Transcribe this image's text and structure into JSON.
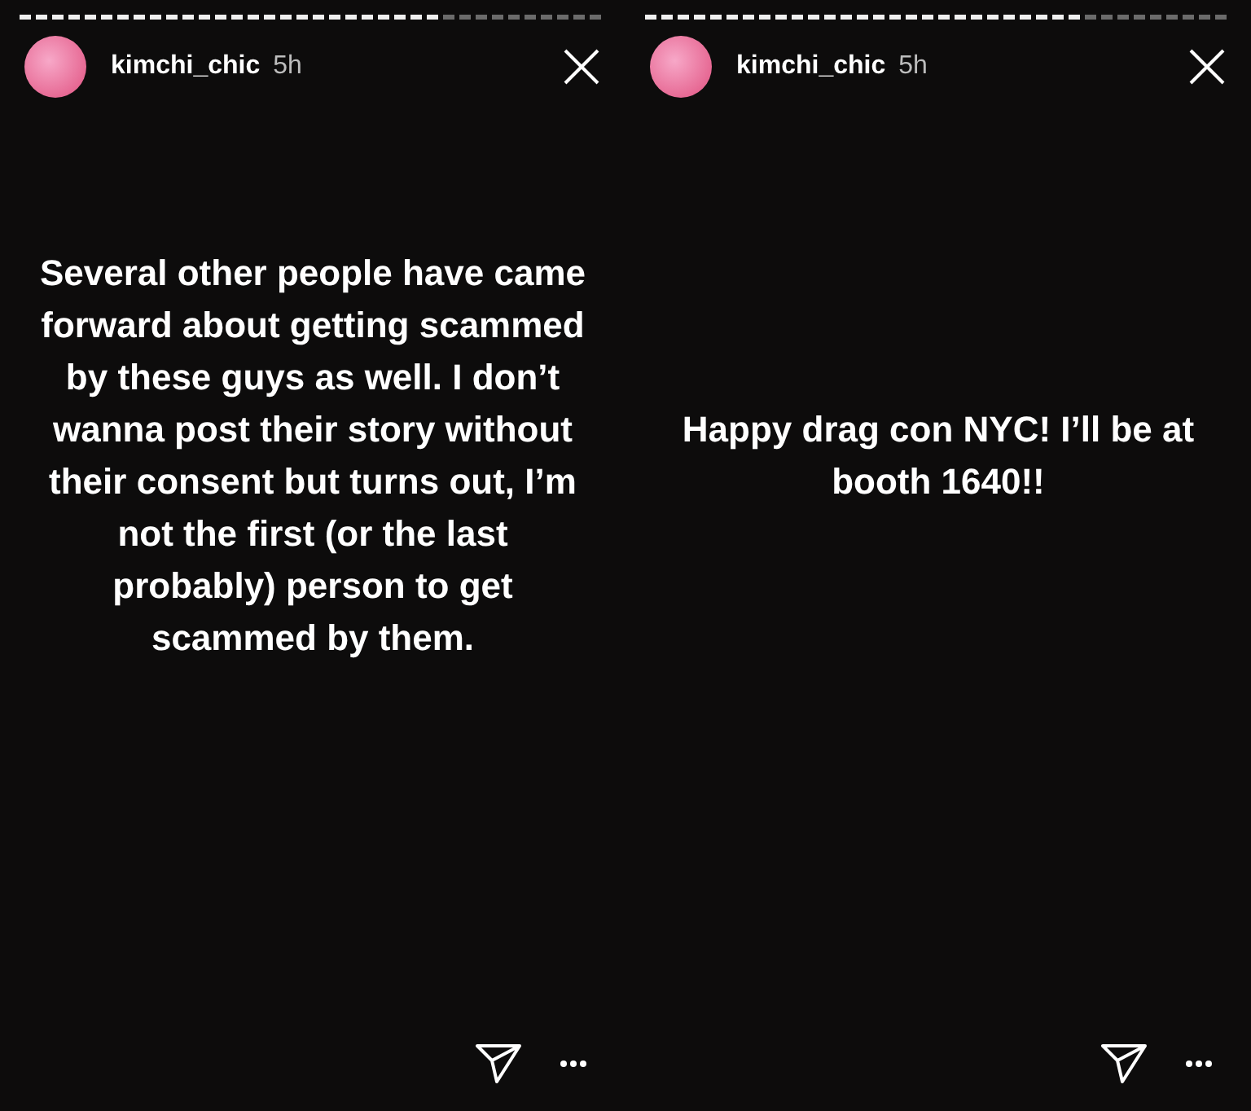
{
  "stories": [
    {
      "progress": {
        "level": 0.73
      },
      "username": "kimchi_chic",
      "time": "5h",
      "message": "Several other people have came forward about getting scammed by these guys as well. I don’t wanna post their story without their consent but turns out, I’m not the first (or the last probably) person to get scammed by them."
    },
    {
      "progress": {
        "level": 0.76
      },
      "username": "kimchi_chic",
      "time": "5h",
      "message": "Happy drag con NYC! I’ll be at booth 1640!!"
    }
  ]
}
